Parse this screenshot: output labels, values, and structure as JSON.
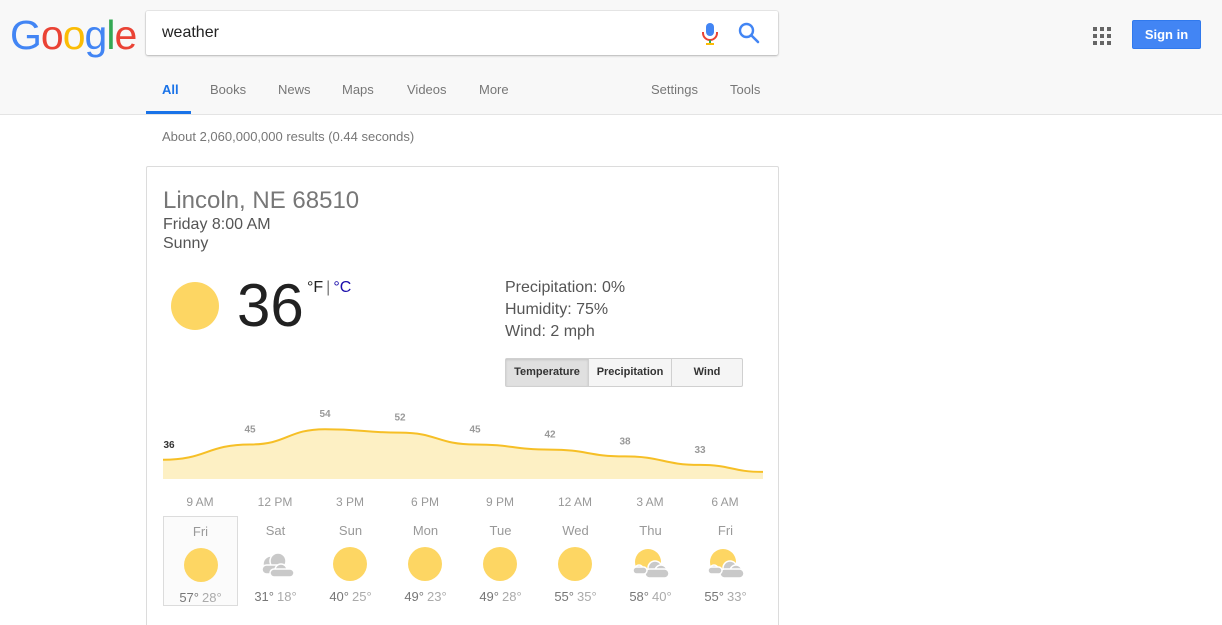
{
  "header": {
    "logo_letters": [
      {
        "char": "G",
        "color": "#4285F4"
      },
      {
        "char": "o",
        "color": "#EA4335"
      },
      {
        "char": "o",
        "color": "#FBBC05"
      },
      {
        "char": "g",
        "color": "#4285F4"
      },
      {
        "char": "l",
        "color": "#34A853"
      },
      {
        "char": "e",
        "color": "#EA4335"
      }
    ],
    "search_query": "weather",
    "sign_in_label": "Sign in"
  },
  "nav": {
    "items": [
      "All",
      "Books",
      "News",
      "Maps",
      "Videos",
      "More"
    ],
    "active": "All",
    "settings_label": "Settings",
    "tools_label": "Tools"
  },
  "results": {
    "stats": "About 2,060,000,000 results (0.44 seconds)"
  },
  "weather": {
    "location": "Lincoln, NE 68510",
    "daytime": "Friday 8:00 AM",
    "condition": "Sunny",
    "current_temp": "36",
    "unit_f": "°F",
    "unit_sep": "|",
    "unit_c": "°C",
    "precipitation": "Precipitation: 0%",
    "humidity": "Humidity: 75%",
    "wind": "Wind: 2 mph",
    "tabs": [
      "Temperature",
      "Precipitation",
      "Wind"
    ],
    "selected_tab": "Temperature",
    "hourly_labels": [
      "9 AM",
      "12 PM",
      "3 PM",
      "6 PM",
      "9 PM",
      "12 AM",
      "3 AM",
      "6 AM"
    ],
    "hourly_temps": [
      36,
      45,
      54,
      52,
      45,
      42,
      38,
      33
    ],
    "accent_color": "#fdd663",
    "line_color": "#f6bf26",
    "fill_color": "#fdf0c4",
    "daily": [
      {
        "day": "Fri",
        "icon": "sun-icon",
        "hi": "57°",
        "lo": "28°"
      },
      {
        "day": "Sat",
        "icon": "cloudy-icon",
        "hi": "31°",
        "lo": "18°"
      },
      {
        "day": "Sun",
        "icon": "sun-icon",
        "hi": "40°",
        "lo": "25°"
      },
      {
        "day": "Mon",
        "icon": "sun-icon",
        "hi": "49°",
        "lo": "23°"
      },
      {
        "day": "Tue",
        "icon": "sun-icon",
        "hi": "49°",
        "lo": "28°"
      },
      {
        "day": "Wed",
        "icon": "sun-icon",
        "hi": "55°",
        "lo": "35°"
      },
      {
        "day": "Thu",
        "icon": "partly-cloudy-icon",
        "hi": "58°",
        "lo": "40°"
      },
      {
        "day": "Fri",
        "icon": "partly-cloudy-icon",
        "hi": "55°",
        "lo": "33°"
      }
    ],
    "selected_day_index": 0
  }
}
